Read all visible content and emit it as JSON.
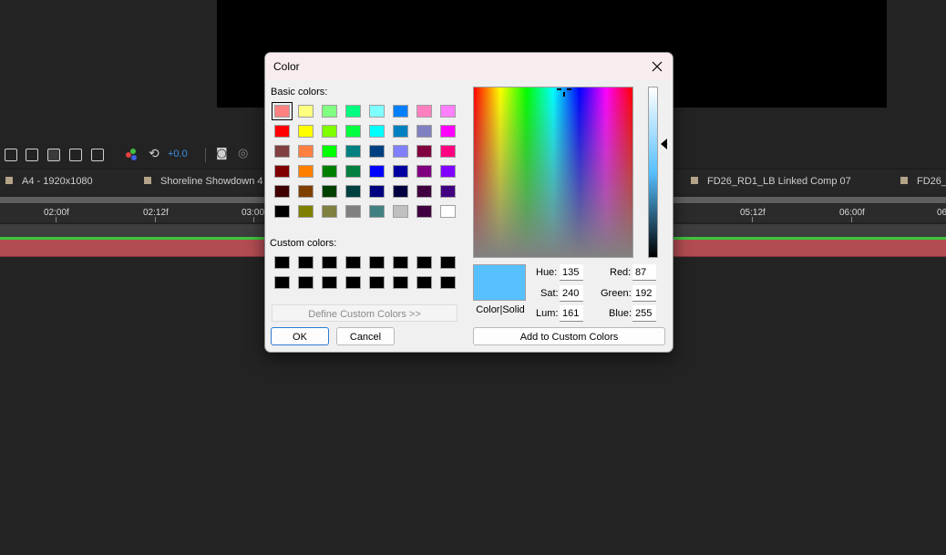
{
  "host": {
    "toolbar": {
      "exposure_value": "+0.0"
    },
    "tabs": [
      {
        "label": "A4 - 1920x1080"
      },
      {
        "label": "Shoreline Showdown 4"
      },
      {
        "label": "FD26_RD1_LB Linked Comp 07"
      },
      {
        "label": "FD26_"
      }
    ],
    "ruler": {
      "labels": [
        "02:00f",
        "02:12f",
        "03:00",
        "05:12f",
        "06:00f",
        "06"
      ]
    }
  },
  "dialog": {
    "title": "Color",
    "basic_colors_label": "Basic colors:",
    "custom_colors_label": "Custom colors:",
    "basic_colors": [
      [
        "#ff8080",
        "#ffff80",
        "#80ff80",
        "#00ff80",
        "#80ffff",
        "#0080ff",
        "#ff80c0",
        "#ff80ff"
      ],
      [
        "#ff0000",
        "#ffff00",
        "#80ff00",
        "#00ff40",
        "#00ffff",
        "#0080c0",
        "#8080c0",
        "#ff00ff"
      ],
      [
        "#804040",
        "#ff8040",
        "#00ff00",
        "#008080",
        "#004080",
        "#8080ff",
        "#800040",
        "#ff0080"
      ],
      [
        "#800000",
        "#ff8000",
        "#008000",
        "#008040",
        "#0000ff",
        "#0000a0",
        "#800080",
        "#8000ff"
      ],
      [
        "#400000",
        "#804000",
        "#004000",
        "#004040",
        "#000080",
        "#000040",
        "#400040",
        "#400080"
      ],
      [
        "#000000",
        "#808000",
        "#808040",
        "#808080",
        "#408080",
        "#c0c0c0",
        "#400040",
        "#ffffff"
      ]
    ],
    "selected_basic": "#ff8080",
    "custom_colors": [
      [
        "#000000",
        "#000000",
        "#000000",
        "#000000",
        "#000000",
        "#000000",
        "#000000",
        "#000000"
      ],
      [
        "#000000",
        "#000000",
        "#000000",
        "#000000",
        "#000000",
        "#000000",
        "#000000",
        "#000000"
      ]
    ],
    "define_custom_label": "Define Custom Colors >>",
    "ok_label": "OK",
    "cancel_label": "Cancel",
    "add_custom_label": "Add to Custom Colors",
    "color_solid_label": "Color|Solid",
    "current_color": "#57c0ff",
    "fields": {
      "hue_label": "Hue:",
      "hue": "135",
      "sat_label": "Sat:",
      "sat": "240",
      "lum_label": "Lum:",
      "lum": "161",
      "red_label": "Red:",
      "red": "87",
      "green_label": "Green:",
      "green": "192",
      "blue_label": "Blue:",
      "blue": "255"
    }
  }
}
